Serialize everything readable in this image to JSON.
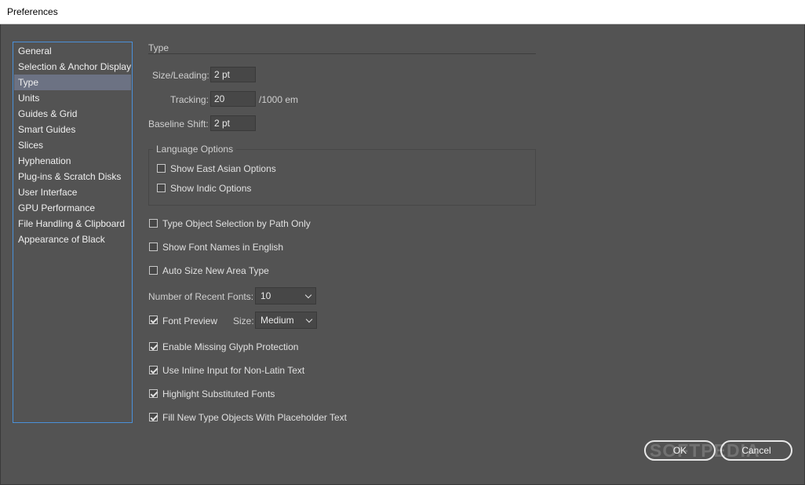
{
  "window": {
    "title": "Preferences"
  },
  "sidebar": {
    "items": [
      {
        "label": "General"
      },
      {
        "label": "Selection & Anchor Display"
      },
      {
        "label": "Type"
      },
      {
        "label": "Units"
      },
      {
        "label": "Guides & Grid"
      },
      {
        "label": "Smart Guides"
      },
      {
        "label": "Slices"
      },
      {
        "label": "Hyphenation"
      },
      {
        "label": "Plug-ins & Scratch Disks"
      },
      {
        "label": "User Interface"
      },
      {
        "label": "GPU Performance"
      },
      {
        "label": "File Handling & Clipboard"
      },
      {
        "label": "Appearance of Black"
      }
    ],
    "selected": "Type"
  },
  "type_panel": {
    "section_title": "Type",
    "size_leading": {
      "label": "Size/Leading:",
      "value": "2 pt"
    },
    "tracking": {
      "label": "Tracking:",
      "value": "20",
      "unit": "/1000 em"
    },
    "baseline_shift": {
      "label": "Baseline Shift:",
      "value": "2 pt"
    },
    "language_options": {
      "title": "Language Options",
      "show_east_asian": {
        "label": "Show East Asian Options",
        "checked": false
      },
      "show_indic": {
        "label": "Show Indic Options",
        "checked": false
      }
    },
    "type_object_selection": {
      "label": "Type Object Selection by Path Only",
      "checked": false
    },
    "show_font_names_english": {
      "label": "Show Font Names in English",
      "checked": false
    },
    "auto_size_area_type": {
      "label": "Auto Size New Area Type",
      "checked": false
    },
    "recent_fonts": {
      "label": "Number of Recent Fonts:",
      "value": "10"
    },
    "font_preview": {
      "label": "Font Preview",
      "checked": true,
      "size_label": "Size:",
      "size_value": "Medium"
    },
    "missing_glyph": {
      "label": "Enable Missing Glyph Protection",
      "checked": true
    },
    "inline_input": {
      "label": "Use Inline Input for Non-Latin Text",
      "checked": true
    },
    "highlight_substituted": {
      "label": "Highlight Substituted Fonts",
      "checked": true
    },
    "placeholder_text": {
      "label": "Fill New Type Objects With Placeholder Text",
      "checked": true
    }
  },
  "buttons": {
    "ok": "OK",
    "cancel": "Cancel"
  },
  "watermark": "SOFTPEDIA",
  "colors": {
    "background": "#535353",
    "selection": "#6c7283",
    "focus_border": "#4a90d9"
  }
}
